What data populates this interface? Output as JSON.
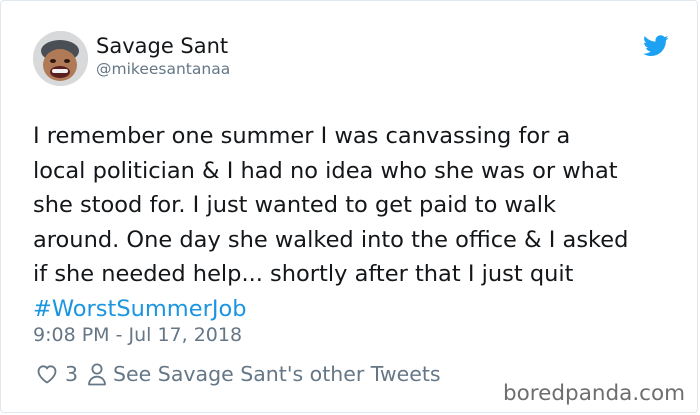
{
  "user": {
    "name": "Savage Sant",
    "handle": "@mikeesantanaa"
  },
  "tweet": {
    "lines": [
      "I remember one summer I was canvassing for a",
      "local politician & I had no idea who she was or what",
      "she stood for. I just wanted to get paid to walk",
      "around. One day she walked into the office & I asked",
      "if she needed help... shortly after that I just quit"
    ],
    "hashtag": "#WorstSummerJob",
    "timestamp": "9:08 PM - Jul 17, 2018"
  },
  "actions": {
    "like_count": "3",
    "other_tweets_label": "See Savage Sant's other Tweets"
  },
  "watermark": "boredpanda.com",
  "colors": {
    "brand_blue": "#1b95e0",
    "twitter_bird": "#1da1f2",
    "muted": "#657786"
  },
  "icons": {
    "bird": "twitter-bird-icon",
    "like": "heart-icon",
    "profile": "person-icon"
  }
}
